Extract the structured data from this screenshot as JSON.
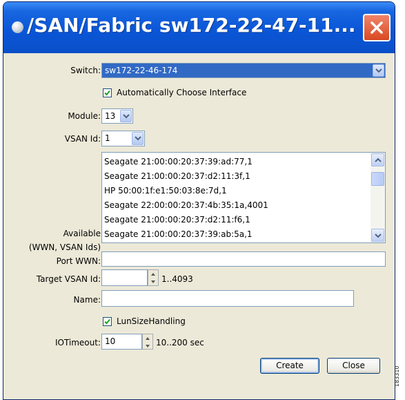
{
  "window": {
    "title": "/SAN/Fabric sw172-22-47-11..."
  },
  "form": {
    "switch": {
      "label": "Switch:",
      "value": "sw172-22-46-174"
    },
    "auto_interface": {
      "label": "Automatically Choose Interface",
      "checked": true
    },
    "module": {
      "label": "Module:",
      "value": "13"
    },
    "vsan_id": {
      "label": "VSAN Id:",
      "value": "1"
    },
    "available": {
      "label_line1": "Available",
      "label_line2": "(WWN, VSAN Ids)",
      "items": [
        "Seagate 21:00:00:20:37:39:ad:77,1",
        "Seagate 21:00:00:20:37:d2:11:3f,1",
        "HP 50:00:1f:e1:50:03:8e:7d,1",
        "Seagate 22:00:00:20:37:4b:35:1a,4001",
        "Seagate 21:00:00:20:37:d2:11:f6,1",
        "Seagate 21:00:00:20:37:39:ab:5a,1"
      ]
    },
    "port_wwn": {
      "label": "Port WWN:",
      "value": ""
    },
    "target_vsan_id": {
      "label": "Target VSAN Id:",
      "value": "",
      "range": "1..4093"
    },
    "name": {
      "label": "Name:",
      "value": ""
    },
    "lun_size_handling": {
      "label": "LunSizeHandling",
      "checked": true
    },
    "io_timeout": {
      "label": "IOTimeout:",
      "value": "10",
      "range": "10..200 sec"
    }
  },
  "buttons": {
    "create": "Create",
    "close": "Close"
  },
  "watermark": "183310"
}
